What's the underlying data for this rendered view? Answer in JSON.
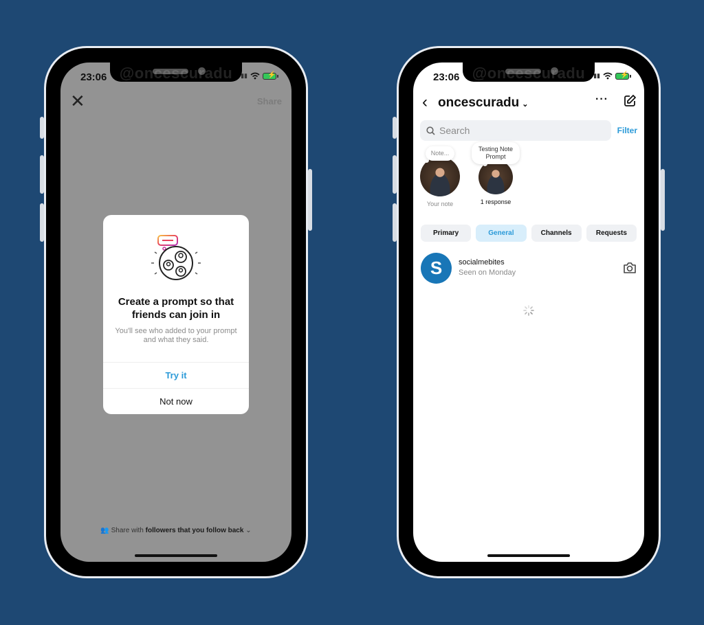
{
  "left_phone": {
    "status": {
      "time": "23:06",
      "watermark": "@oncescuradu"
    },
    "header": {
      "close_icon": "close-icon",
      "share_label": "Share"
    },
    "modal": {
      "illustration": "group-prompt-illustration",
      "title": "Create a prompt so that friends can join in",
      "subtitle": "You'll see who added to your prompt and what they said.",
      "primary_label": "Try it",
      "secondary_label": "Not now"
    },
    "share_with": {
      "prefix": "Share with",
      "audience": "followers that you follow back",
      "icon": "people-icon"
    }
  },
  "right_phone": {
    "status": {
      "time": "23:06",
      "watermark": "@oncescuradu"
    },
    "header": {
      "username": "oncescuradu",
      "more_icon": "more-icon",
      "compose_icon": "compose-icon"
    },
    "search": {
      "placeholder": "Search",
      "value": ""
    },
    "filter_label": "Filter",
    "notes": [
      {
        "bubble": "Note...",
        "caption": "Your note"
      },
      {
        "bubble": "Testing Note Prompt",
        "caption": "1 response"
      }
    ],
    "tabs": [
      {
        "label": "Primary",
        "active": false
      },
      {
        "label": "General",
        "active": true
      },
      {
        "label": "Channels",
        "active": false
      },
      {
        "label": "Requests",
        "active": false
      }
    ],
    "conversations": [
      {
        "name": "socialmebites",
        "status": "Seen on Monday",
        "avatar_letter": "S"
      }
    ]
  },
  "colors": {
    "background": "#1e4873",
    "accent": "#2b9ad8",
    "tab_active_bg": "#d8eefb"
  }
}
